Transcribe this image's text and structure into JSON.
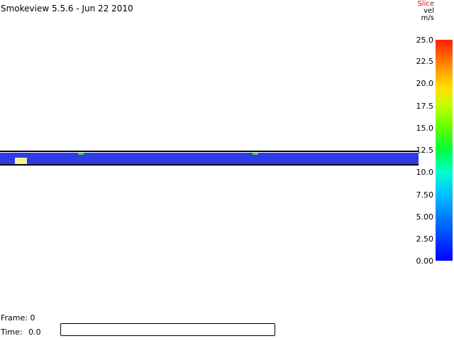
{
  "app": {
    "title": "Smokeview 5.5.6 - Jun 22 2010"
  },
  "colorbar": {
    "type_label": "Slice",
    "quantity": "vel",
    "units": "m/s",
    "type_label_color": "#cc0000",
    "ticks": [
      "25.0",
      "22.5",
      "20.0",
      "17.5",
      "15.0",
      "12.5",
      "10.0",
      "7.50",
      "5.00",
      "2.50",
      "0.00"
    ]
  },
  "scene": {
    "slice_color": "#2e3ce8",
    "vent_color": "#f3f09a",
    "mark_color": "#38d438"
  },
  "footer": {
    "frame_label": "Frame:",
    "frame_value": "0",
    "time_label": "Time:",
    "time_value": "0.0"
  }
}
